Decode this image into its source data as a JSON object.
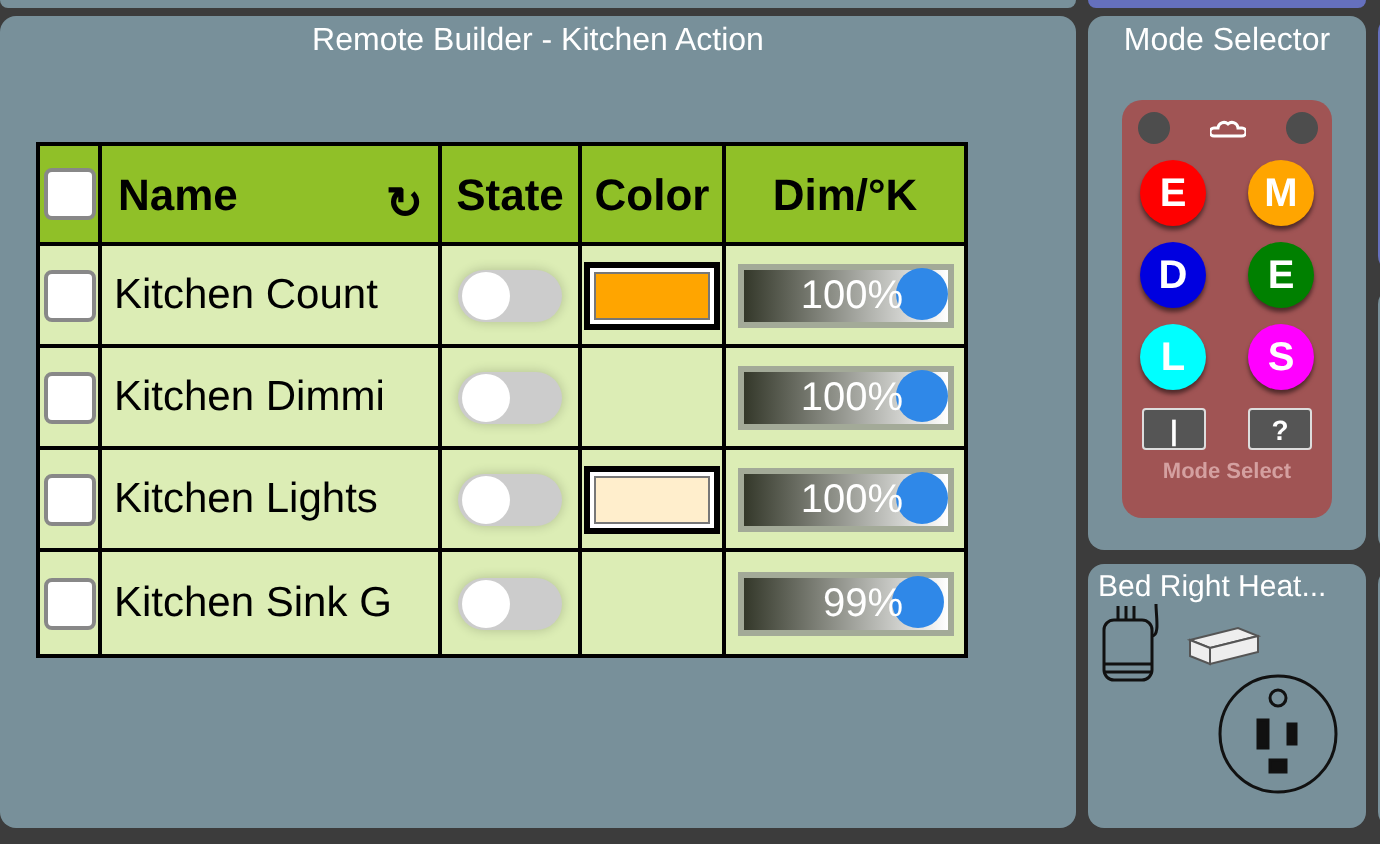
{
  "main_tile": {
    "title": "Remote Builder - Kitchen Action",
    "table": {
      "select_all": {
        "checked": false
      },
      "columns": [
        "Name",
        "State",
        "Color",
        "Dim/°K"
      ],
      "refresh": "↻",
      "rows": [
        {
          "checked": false,
          "name": "Kitchen Count",
          "on": false,
          "color": "#ffa500",
          "dim": "100%",
          "level": 1.0
        },
        {
          "checked": false,
          "name": "Kitchen Dimmi",
          "on": false,
          "dim": "100%",
          "level": 1.0
        },
        {
          "checked": false,
          "name": "Kitchen Lights",
          "on": false,
          "color": "#ffeecc",
          "dim": "100%",
          "level": 1.0
        },
        {
          "checked": false,
          "name": "Kitchen Sink G",
          "on": false,
          "dim": "99%",
          "level": 0.99
        }
      ]
    }
  },
  "mode_selector": {
    "title": "Mode Selector",
    "buttons": [
      {
        "label": "E",
        "color": "#ff0000"
      },
      {
        "label": "M",
        "color": "#ffa500"
      },
      {
        "label": "D",
        "color": "#0000e0"
      },
      {
        "label": "E",
        "color": "#008000"
      },
      {
        "label": "L",
        "color": "#00ffff"
      },
      {
        "label": "S",
        "color": "#ff00ff"
      }
    ],
    "small_buttons": [
      "|",
      "?"
    ],
    "footer": "Mode Select"
  },
  "device_tile": {
    "title": "Bed Right Heat..."
  }
}
